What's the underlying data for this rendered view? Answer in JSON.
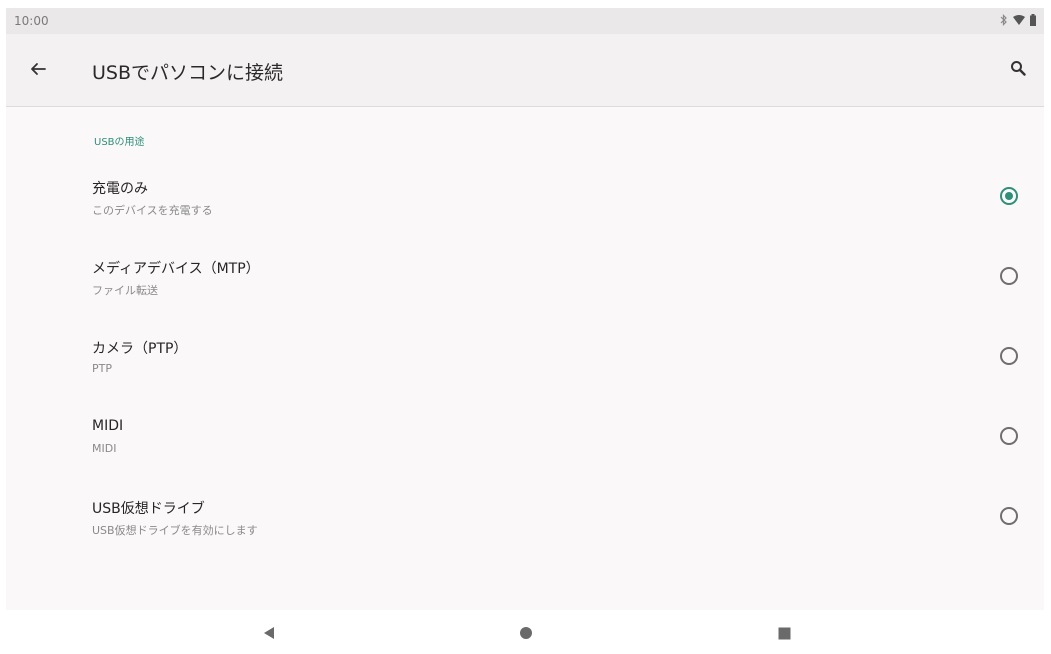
{
  "status_bar": {
    "time": "10:00",
    "icons": [
      "bluetooth-icon",
      "wifi-icon",
      "battery-icon"
    ]
  },
  "toolbar": {
    "title": "USBでパソコンに接続",
    "back_icon": "arrow-left-icon",
    "search_icon": "search-icon"
  },
  "section": {
    "header": "USBの用途"
  },
  "options": [
    {
      "title": "充電のみ",
      "summary": "このデバイスを充電する",
      "selected": true
    },
    {
      "title": "メディアデバイス（MTP）",
      "summary": "ファイル転送",
      "selected": false
    },
    {
      "title": "カメラ（PTP）",
      "summary": "PTP",
      "selected": false
    },
    {
      "title": "MIDI",
      "summary": "MIDI",
      "selected": false
    },
    {
      "title": "USB仮想ドライブ",
      "summary": "USB仮想ドライブを有効にします",
      "selected": false
    }
  ],
  "nav_bar": {
    "icons": [
      "back-triangle-icon",
      "home-circle-icon",
      "recents-square-icon"
    ]
  },
  "colors": {
    "accent": "#2f8f79",
    "toolbar_bg": "#f4f1f3",
    "content_bg": "#fbf8fa"
  }
}
